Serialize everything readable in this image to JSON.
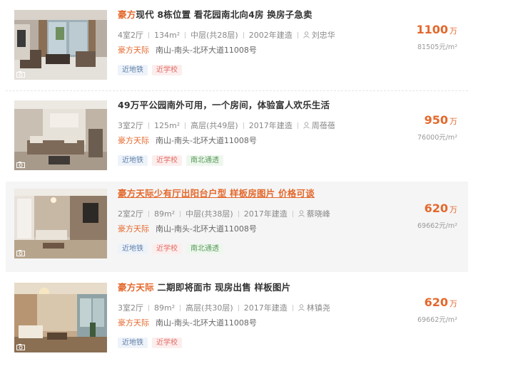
{
  "listings": [
    {
      "title_highlight": "豪方",
      "title_rest": "现代 8栋位置 看花园南北向4房 换房子急卖",
      "layout": "4室2厅",
      "area": "134m²",
      "floor": "中层(共28层)",
      "built": "2002年建造",
      "agent": "刘忠华",
      "community": "豪方天际",
      "address": "南山-南头-北环大道11008号",
      "tags": [
        "近地铁",
        "近学校"
      ],
      "price": "1100",
      "price_unit": "万",
      "unit_price": "81505元/m²"
    },
    {
      "title_highlight": "",
      "title_rest": "49万平公园南外可用，一个房间，体验富人欢乐生活",
      "layout": "3室2厅",
      "area": "125m²",
      "floor": "高层(共49层)",
      "built": "2017年建造",
      "agent": "周蓓蓓",
      "community": "豪方天际",
      "address": "南山-南头-北环大道11008号",
      "tags": [
        "近地铁",
        "近学校",
        "南北通透"
      ],
      "price": "950",
      "price_unit": "万",
      "unit_price": "76000元/m²"
    },
    {
      "title_highlight": "",
      "title_rest": "豪方天际少有厅出阳台户型 样板房图片 价格可谈",
      "layout": "2室2厅",
      "area": "89m²",
      "floor": "中层(共38层)",
      "built": "2017年建造",
      "agent": "蔡晓峰",
      "community": "豪方天际",
      "address": "南山-南头-北环大道11008号",
      "tags": [
        "近地铁",
        "近学校",
        "南北通透"
      ],
      "price": "620",
      "price_unit": "万",
      "unit_price": "69662元/m²"
    },
    {
      "title_highlight": "豪方天际",
      "title_rest": " 二期即将面市 现房出售 样板图片",
      "layout": "3室2厅",
      "area": "89m²",
      "floor": "高层(共30层)",
      "built": "2017年建造",
      "agent": "林镇尧",
      "community": "豪方天际",
      "address": "南山-南头-北环大道11008号",
      "tags": [
        "近地铁",
        "近学校"
      ],
      "price": "620",
      "price_unit": "万",
      "unit_price": "69662元/m²"
    }
  ],
  "colors": {
    "accent": "#e4682c",
    "hover_bg": "#f5f5f5",
    "tag_blue": "#5f7ea6",
    "tag_red": "#e06c63",
    "tag_green": "#5a9b5b"
  },
  "icons": {
    "agent": "person-icon",
    "photo": "camera-icon"
  }
}
